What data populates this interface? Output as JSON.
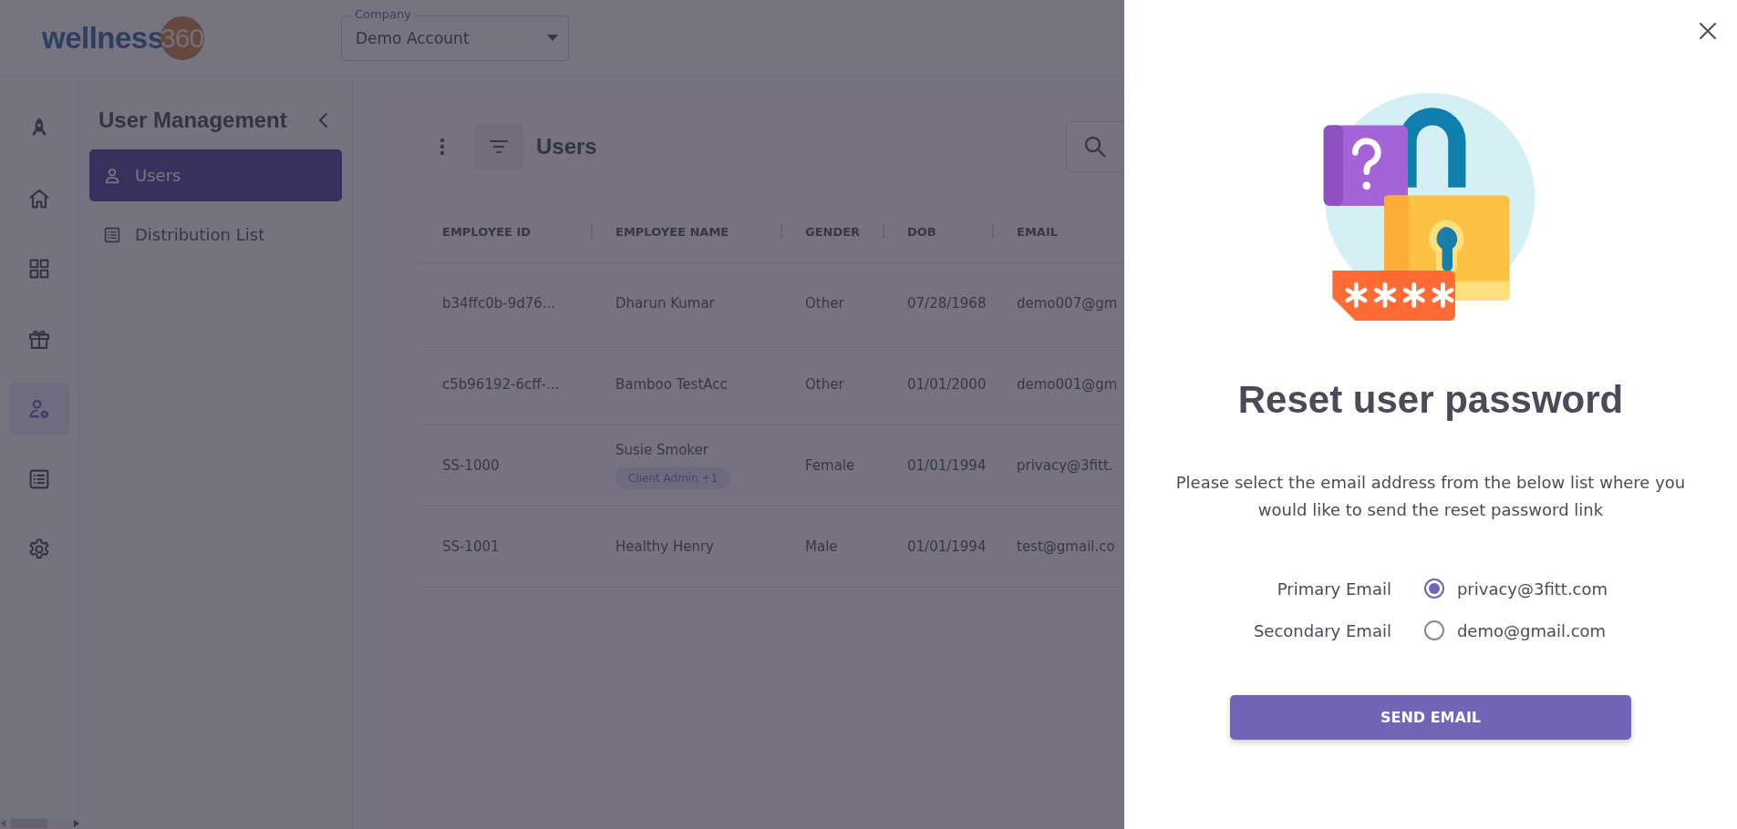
{
  "header": {
    "logo": {
      "word": "wellness",
      "number": "360"
    },
    "company_field": {
      "label": "Company",
      "value": "Demo Account"
    }
  },
  "icon_rail": [
    {
      "kind": "rocket",
      "selected": false
    },
    {
      "kind": "home",
      "selected": false
    },
    {
      "kind": "grid",
      "selected": false
    },
    {
      "kind": "gift",
      "selected": false
    },
    {
      "kind": "user-gear",
      "selected": true
    },
    {
      "kind": "list",
      "selected": false
    },
    {
      "kind": "gear",
      "selected": false
    }
  ],
  "sub_sidebar": {
    "title": "User Management",
    "items": [
      {
        "label": "Users",
        "kind": "person",
        "selected": true
      },
      {
        "label": "Distribution List",
        "kind": "list",
        "selected": false
      }
    ]
  },
  "users_panel": {
    "title": "Users",
    "table": {
      "columns": [
        "EMPLOYEE ID",
        "EMPLOYEE NAME",
        "GENDER",
        "DOB",
        "EMAIL"
      ],
      "rows": [
        {
          "cells": [
            "b34ffc0b-9d76...",
            "Dharun Kumar",
            "Other",
            "07/28/1968",
            "demo007@gm"
          ]
        },
        {
          "cells": [
            "c5b96192-6cff-...",
            "Bamboo TestAcc",
            "Other",
            "01/01/2000",
            "demo001@gm"
          ]
        },
        {
          "cells": [
            "SS-1000",
            "Susie Smoker",
            "Female",
            "01/01/1994",
            "privacy@3fitt."
          ],
          "tag": "Client Admin +1"
        },
        {
          "cells": [
            "SS-1001",
            "Healthy Henry",
            "Male",
            "01/01/1994",
            "test@gmail.co"
          ]
        }
      ]
    }
  },
  "drawer": {
    "title": "Reset user password",
    "message": "Please select the email address from the below list where you would like to send the reset password link",
    "options": [
      {
        "label": "Primary Email",
        "email": "privacy@3fitt.com",
        "selected": true
      },
      {
        "label": "Secondary Email",
        "email": "demo@gmail.com",
        "selected": false
      }
    ],
    "button": "SEND EMAIL"
  }
}
